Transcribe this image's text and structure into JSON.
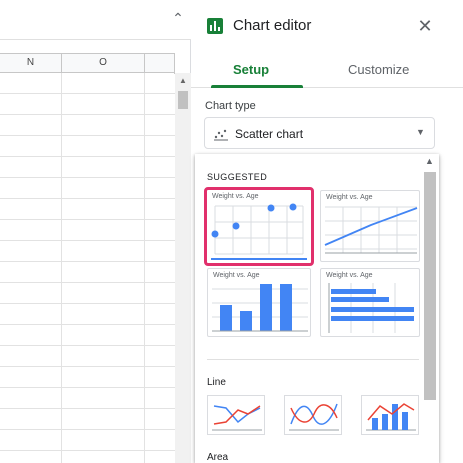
{
  "sheet": {
    "columns": [
      "",
      "N",
      "O"
    ],
    "formula_toggle_icon": "chevron-up-icon"
  },
  "panel": {
    "title": "Chart editor",
    "close_icon": "close-icon",
    "tabs": [
      {
        "label": "Setup",
        "active": true
      },
      {
        "label": "Customize",
        "active": false
      }
    ],
    "chart_type_label": "Chart type",
    "chart_type_value": "Scatter chart",
    "accent_color": "#188038"
  },
  "dropdown": {
    "suggested_label": "SUGGESTED",
    "suggested": [
      {
        "title": "Weight vs. Age",
        "kind": "scatter",
        "selected": true
      },
      {
        "title": "Weight vs. Age",
        "kind": "line",
        "selected": false
      },
      {
        "title": "Weight vs. Age",
        "kind": "column",
        "selected": false
      },
      {
        "title": "Weight vs. Age",
        "kind": "bar",
        "selected": false
      }
    ],
    "line_section": "Line",
    "line_options": [
      "line-chart-icon",
      "smooth-line-chart-icon",
      "combo-chart-icon"
    ],
    "area_section": "Area",
    "highlight_color": "#e1306c",
    "blue": "#4285f4",
    "red": "#ea4335"
  }
}
